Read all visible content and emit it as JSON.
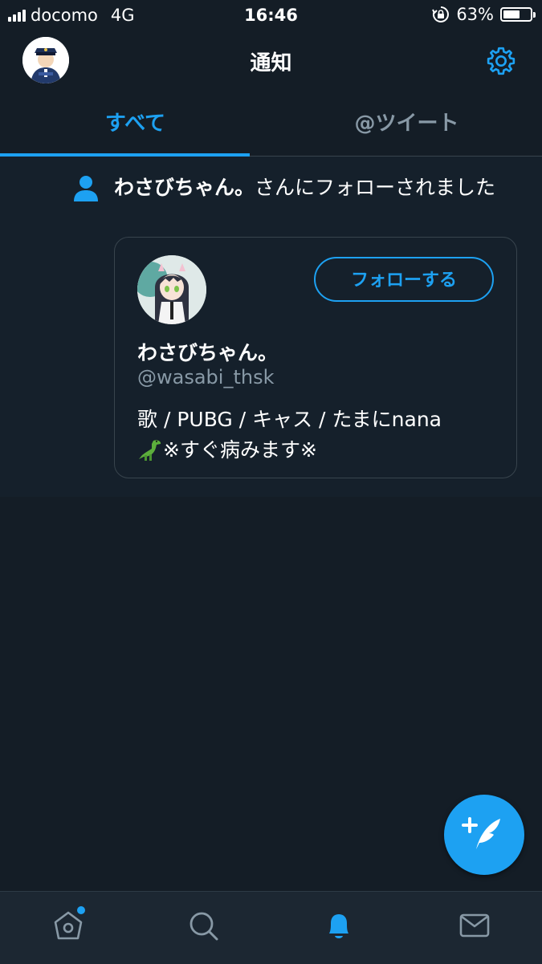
{
  "status_bar": {
    "carrier": "docomo",
    "network": "4G",
    "time": "16:46",
    "battery_percent_label": "63%",
    "battery_level": 0.63
  },
  "header": {
    "title": "通知",
    "avatar_icon": "police-avatar-icon",
    "settings_icon": "gear-icon"
  },
  "tabs": [
    {
      "label": "すべて",
      "active": true
    },
    {
      "label": "@ツイート",
      "active": false
    }
  ],
  "notification": {
    "icon": "person-icon",
    "user_name": "わさびちゃん。",
    "action_text": "さんにフォローされました",
    "card": {
      "name": "わさびちゃん。",
      "handle": "@wasabi_thsk",
      "follow_label": "フォローする",
      "bio_line1": "歌 / PUBG / キャス / たまにnana",
      "bio_line2": "※すぐ病みます※",
      "bio_emoji": "dinosaur-icon"
    }
  },
  "compose_button": {
    "icon": "compose-tweet-icon"
  },
  "bottom_nav": [
    {
      "icon": "home-icon",
      "has_badge": true
    },
    {
      "icon": "search-icon",
      "has_badge": false
    },
    {
      "icon": "bell-icon",
      "active": true
    },
    {
      "icon": "mail-icon",
      "has_badge": false
    }
  ],
  "colors": {
    "accent": "#1da1f2",
    "background": "#141d26",
    "surface": "#15202b",
    "secondary_text": "#8899a6",
    "border": "#38444d"
  }
}
